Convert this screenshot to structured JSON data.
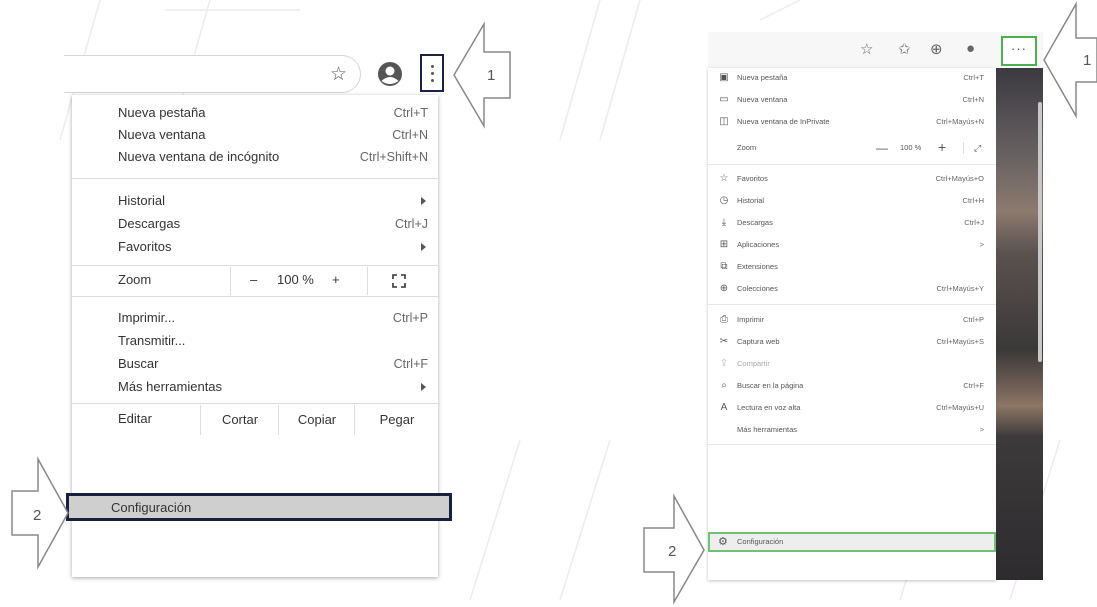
{
  "colors": {
    "chrome_highlight": "#17213f",
    "edge_highlight": "#6fc173",
    "arrow_stroke": "#888888"
  },
  "callouts": {
    "chrome_menu_step": "1",
    "chrome_config_step": "2",
    "edge_menu_step": "1",
    "edge_config_step": "2"
  },
  "chrome": {
    "toolbar_icons": [
      "star-icon",
      "account-icon",
      "three-dots-icon"
    ],
    "menu": {
      "new_tab": {
        "label": "Nueva pestaña",
        "shortcut": "Ctrl+T"
      },
      "new_window": {
        "label": "Nueva ventana",
        "shortcut": "Ctrl+N"
      },
      "incognito": {
        "label": "Nueva ventana de incógnito",
        "shortcut": "Ctrl+Shift+N"
      },
      "history": {
        "label": "Historial"
      },
      "downloads": {
        "label": "Descargas",
        "shortcut": "Ctrl+J"
      },
      "bookmarks": {
        "label": "Favoritos"
      },
      "zoom": {
        "label": "Zoom",
        "minus": "–",
        "value": "100 %",
        "plus": "+"
      },
      "print": {
        "label": "Imprimir...",
        "shortcut": "Ctrl+P"
      },
      "cast": {
        "label": "Transmitir..."
      },
      "find": {
        "label": "Buscar",
        "shortcut": "Ctrl+F"
      },
      "more_tools": {
        "label": "Más herramientas"
      },
      "edit": {
        "label": "Editar",
        "cut": "Cortar",
        "copy": "Copiar",
        "paste": "Pegar"
      },
      "settings": {
        "label": "Configuración"
      }
    }
  },
  "edge": {
    "menu": {
      "new_tab": {
        "label": "Nueva pestaña",
        "shortcut": "Ctrl+T"
      },
      "new_window": {
        "label": "Nueva ventana",
        "shortcut": "Ctrl+N"
      },
      "inprivate": {
        "label": "Nueva ventana de InPrivate",
        "shortcut": "Ctrl+Mayús+N"
      },
      "zoom": {
        "label": "Zoom",
        "minus": "—",
        "value": "100 %",
        "plus": "+",
        "expand": "⤢"
      },
      "favorites": {
        "label": "Favoritos",
        "shortcut": "Ctrl+Mayús+O"
      },
      "history": {
        "label": "Historial",
        "shortcut": "Ctrl+H"
      },
      "downloads": {
        "label": "Descargas",
        "shortcut": "Ctrl+J"
      },
      "apps": {
        "label": "Aplicaciones",
        "shortcut": ">"
      },
      "extensions": {
        "label": "Extensiones"
      },
      "collections": {
        "label": "Colecciones",
        "shortcut": "Ctrl+Mayús+Y"
      },
      "print": {
        "label": "Imprimir",
        "shortcut": "Ctrl+P"
      },
      "web_capture": {
        "label": "Captura web",
        "shortcut": "Ctrl+Mayús+S"
      },
      "share": {
        "label": "Compartir"
      },
      "find": {
        "label": "Buscar en la página",
        "shortcut": "Ctrl+F"
      },
      "read_aloud": {
        "label": "Lectura en voz alta",
        "shortcut": "Ctrl+Mayús+U"
      },
      "more_tools": {
        "label": "Más herramientas",
        "shortcut": ">"
      },
      "settings": {
        "label": "Configuración"
      }
    }
  }
}
